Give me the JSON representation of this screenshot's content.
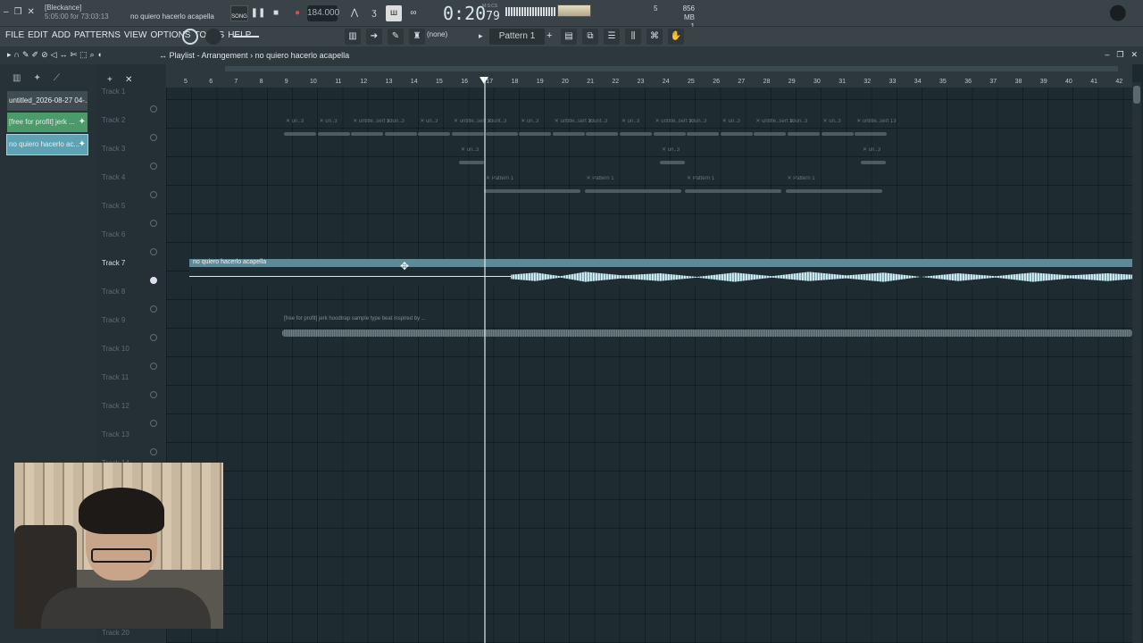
{
  "window": {
    "hint_title": "[Bleckance]",
    "hint_sub": "5:05:00 for 73:03:13",
    "project_title": "no quiero hacerlo acapella",
    "mode_label": "SONG",
    "tempo": "184.000",
    "time_main": "0:20",
    "time_sub": "79",
    "time_label": "M:S:CS",
    "cpu_value": "5",
    "mem_value": "856 MB",
    "mem_sub": "1"
  },
  "menu": [
    "FILE",
    "EDIT",
    "ADD",
    "PATTERNS",
    "VIEW",
    "OPTIONS",
    "TOOLS",
    "HELP"
  ],
  "toolbar": {
    "none_label": "(none)",
    "pattern_label": "Pattern 1"
  },
  "playlist": {
    "breadcrumb_root": "Playlist - Arrangement",
    "breadcrumb_sep": "›",
    "breadcrumb_leaf": "no quiero hacerlo acapella"
  },
  "picker": {
    "items": [
      {
        "label": "untitled_2026-08-27 04-...",
        "color": "#3f4d52"
      },
      {
        "label": "[free for profit] jerk ...",
        "color": "#4a9a6a"
      },
      {
        "label": "no quiero hacerlo ac...",
        "color": "#5ea3b4"
      }
    ]
  },
  "tracks": [
    "Track 1",
    "Track 2",
    "Track 3",
    "Track 4",
    "Track 5",
    "Track 6",
    "Track 7",
    "Track 8",
    "Track 9",
    "Track 10",
    "Track 11",
    "Track 12",
    "Track 13",
    "Track 14",
    "Track 20"
  ],
  "ruler": [
    "5",
    "6",
    "7",
    "8",
    "9",
    "10",
    "11",
    "12",
    "13",
    "14",
    "15",
    "16",
    "17",
    "18",
    "19",
    "20",
    "21",
    "22",
    "23",
    "24",
    "25",
    "26",
    "27",
    "28",
    "29",
    "30",
    "31",
    "32",
    "33",
    "34",
    "35",
    "36",
    "37",
    "38",
    "39",
    "40",
    "41",
    "42"
  ],
  "clips": {
    "track2_labels": [
      "un..3",
      "un..3",
      "untitle..sert 13",
      "un..3",
      "un..3",
      "untitle..sert 13",
      "unt..3",
      "un..3",
      "untitle..sert 13",
      "unt..3",
      "un..3",
      "untitle..sert 13",
      "un..3",
      "un..3",
      "untitle..sert 13",
      "un..3",
      "un..3",
      "untitle..sert 13"
    ],
    "track3_labels": [
      "un..3",
      "un..3",
      "un..3"
    ],
    "track4_labels": [
      "Pattern 1",
      "Pattern 1",
      "Pattern 1",
      "Pattern 1"
    ],
    "vocal": "no quiero hacerlo acapella",
    "beat": "[free for profit] jerk  hoodtrap  sample type beat inspired by ..."
  },
  "colors": {
    "accent": "#5ea3b4",
    "background": "#1e2c31",
    "record": "#e0494b"
  }
}
